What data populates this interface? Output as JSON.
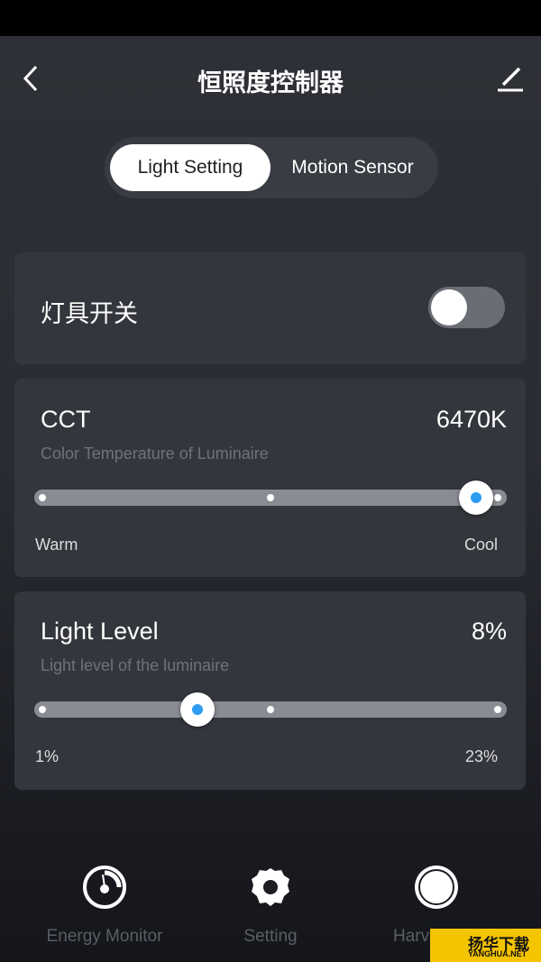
{
  "header": {
    "title": "恒照度控制器",
    "back_icon": "chevron-left-icon",
    "edit_icon": "pencil-icon"
  },
  "tabs": [
    {
      "label": "Light Setting",
      "active": true
    },
    {
      "label": "Motion Sensor",
      "active": false
    }
  ],
  "power": {
    "label": "灯具开关",
    "on": false
  },
  "cct": {
    "title": "CCT",
    "value": "6470K",
    "subtitle": "Color Temperature of Luminaire",
    "min_label": "Warm",
    "max_label": "Cool",
    "position_percent": 95
  },
  "level": {
    "title": "Light Level",
    "value": "8%",
    "subtitle": "Light level of the luminaire",
    "min_label": "1%",
    "max_label": "23%",
    "position_percent": 34
  },
  "bottom_nav": [
    {
      "label": "Energy Monitor",
      "icon": "gauge-icon"
    },
    {
      "label": "Setting",
      "icon": "gear-icon"
    },
    {
      "label": "Harv",
      "icon": "sun-icon"
    }
  ],
  "watermark": {
    "text": "扬华下载",
    "sub": "YANGHUA.NET"
  },
  "colors": {
    "accent": "#2d9cf0"
  }
}
